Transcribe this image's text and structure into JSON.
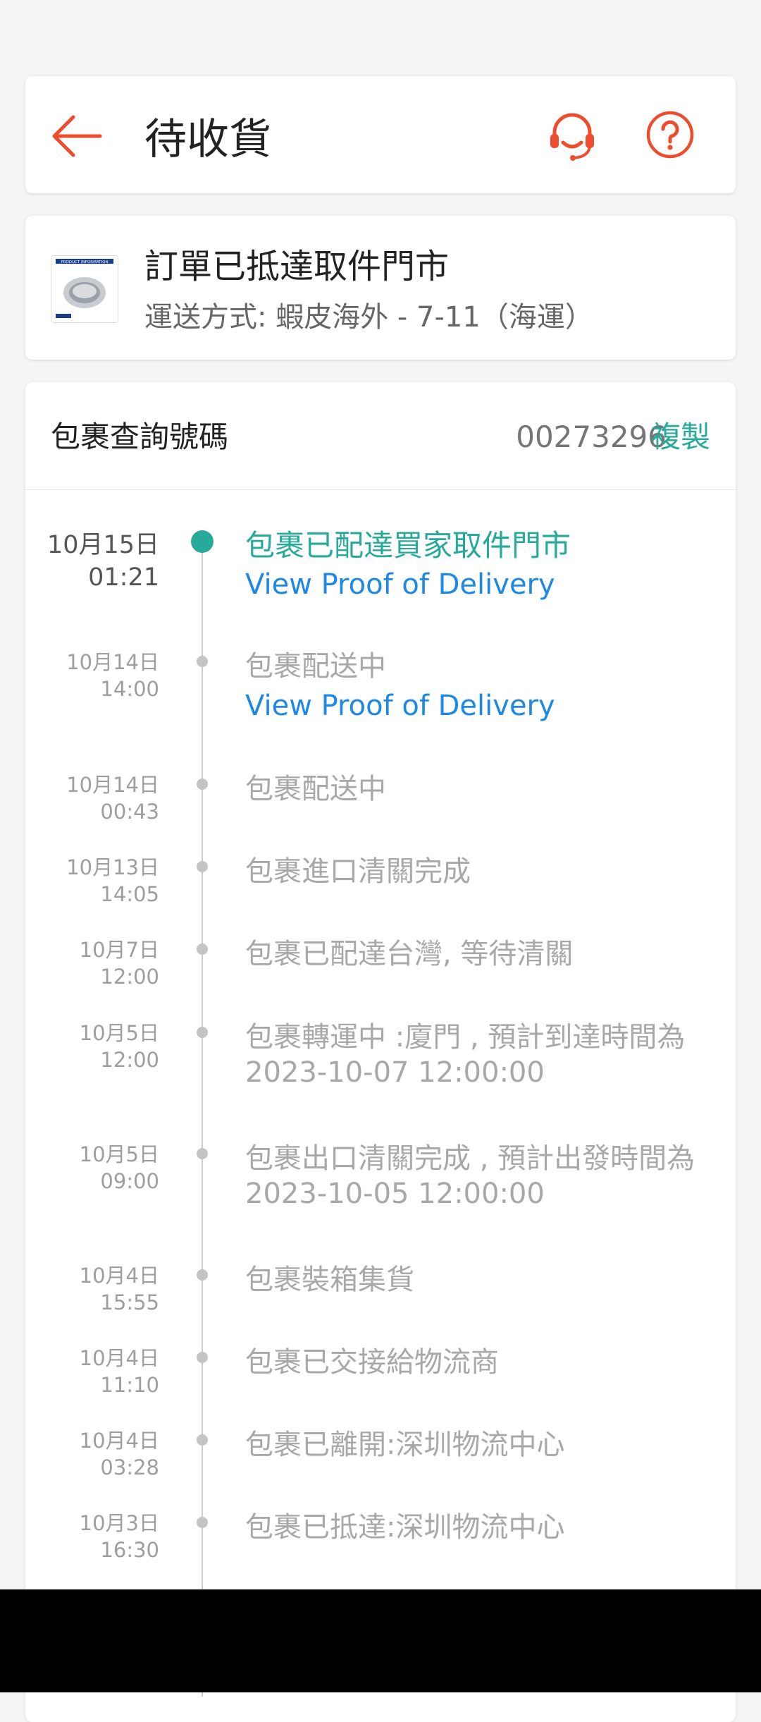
{
  "header": {
    "title": "待收貨",
    "accent": "#ee4d2d",
    "icons": [
      "back-arrow-icon",
      "customer-service-icon",
      "help-icon"
    ]
  },
  "status": {
    "title": "訂單已抵達取件門市",
    "shipping": "運送方式: 蝦皮海外 - 7-11（海運）",
    "thumb_line1": "PRODUCT INFORMATION"
  },
  "tracking": {
    "label": "包裹查詢號碼",
    "number": "00273296",
    "copy_label": "複製",
    "accent": "#26aa99",
    "proof_label": "View Proof of Delivery",
    "events": [
      {
        "date": "10月15日",
        "time": "01:21",
        "text": "包裹已配達買家取件門市",
        "proof": true,
        "active": true
      },
      {
        "date": "10月14日",
        "time": "14:00",
        "text": "包裹配送中",
        "proof": true
      },
      {
        "date": "10月14日",
        "time": "00:43",
        "text": "包裹配送中"
      },
      {
        "date": "10月13日",
        "time": "14:05",
        "text": "包裹進口清關完成"
      },
      {
        "date": "10月7日",
        "time": "12:00",
        "text": "包裹已配達台灣, 等待清關"
      },
      {
        "date": "10月5日",
        "time": "12:00",
        "text": "包裹轉運中 :廈門 , 預計到達時間為 2023-10-07 12:00:00"
      },
      {
        "date": "10月5日",
        "time": "09:00",
        "text": "包裹出口清關完成 , 預計出發時間為 2023-10-05 12:00:00"
      },
      {
        "date": "10月4日",
        "time": "15:55",
        "text": "包裹裝箱集貨"
      },
      {
        "date": "10月4日",
        "time": "11:10",
        "text": "包裹已交接給物流商"
      },
      {
        "date": "10月4日",
        "time": "03:28",
        "text": "包裹已離開:深圳物流中心"
      },
      {
        "date": "10月3日",
        "time": "16:30",
        "text": "包裹已抵達:深圳物流中心"
      }
    ]
  }
}
